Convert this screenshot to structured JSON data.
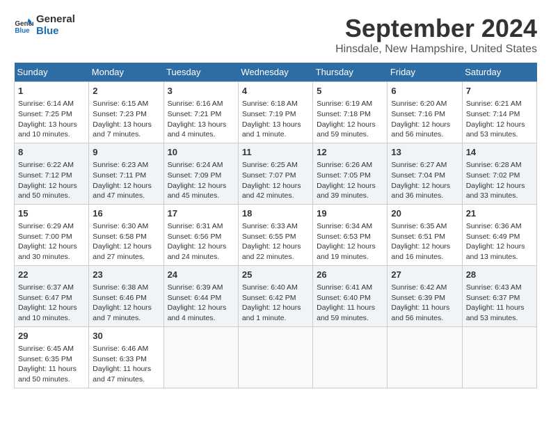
{
  "logo": {
    "text_general": "General",
    "text_blue": "Blue"
  },
  "title": {
    "month_year": "September 2024",
    "location": "Hinsdale, New Hampshire, United States"
  },
  "headers": [
    "Sunday",
    "Monday",
    "Tuesday",
    "Wednesday",
    "Thursday",
    "Friday",
    "Saturday"
  ],
  "weeks": [
    [
      {
        "day": 1,
        "sunrise": "6:14 AM",
        "sunset": "7:25 PM",
        "daylight": "13 hours and 10 minutes."
      },
      {
        "day": 2,
        "sunrise": "6:15 AM",
        "sunset": "7:23 PM",
        "daylight": "13 hours and 7 minutes."
      },
      {
        "day": 3,
        "sunrise": "6:16 AM",
        "sunset": "7:21 PM",
        "daylight": "13 hours and 4 minutes."
      },
      {
        "day": 4,
        "sunrise": "6:18 AM",
        "sunset": "7:19 PM",
        "daylight": "13 hours and 1 minute."
      },
      {
        "day": 5,
        "sunrise": "6:19 AM",
        "sunset": "7:18 PM",
        "daylight": "12 hours and 59 minutes."
      },
      {
        "day": 6,
        "sunrise": "6:20 AM",
        "sunset": "7:16 PM",
        "daylight": "12 hours and 56 minutes."
      },
      {
        "day": 7,
        "sunrise": "6:21 AM",
        "sunset": "7:14 PM",
        "daylight": "12 hours and 53 minutes."
      }
    ],
    [
      {
        "day": 8,
        "sunrise": "6:22 AM",
        "sunset": "7:12 PM",
        "daylight": "12 hours and 50 minutes."
      },
      {
        "day": 9,
        "sunrise": "6:23 AM",
        "sunset": "7:11 PM",
        "daylight": "12 hours and 47 minutes."
      },
      {
        "day": 10,
        "sunrise": "6:24 AM",
        "sunset": "7:09 PM",
        "daylight": "12 hours and 45 minutes."
      },
      {
        "day": 11,
        "sunrise": "6:25 AM",
        "sunset": "7:07 PM",
        "daylight": "12 hours and 42 minutes."
      },
      {
        "day": 12,
        "sunrise": "6:26 AM",
        "sunset": "7:05 PM",
        "daylight": "12 hours and 39 minutes."
      },
      {
        "day": 13,
        "sunrise": "6:27 AM",
        "sunset": "7:04 PM",
        "daylight": "12 hours and 36 minutes."
      },
      {
        "day": 14,
        "sunrise": "6:28 AM",
        "sunset": "7:02 PM",
        "daylight": "12 hours and 33 minutes."
      }
    ],
    [
      {
        "day": 15,
        "sunrise": "6:29 AM",
        "sunset": "7:00 PM",
        "daylight": "12 hours and 30 minutes."
      },
      {
        "day": 16,
        "sunrise": "6:30 AM",
        "sunset": "6:58 PM",
        "daylight": "12 hours and 27 minutes."
      },
      {
        "day": 17,
        "sunrise": "6:31 AM",
        "sunset": "6:56 PM",
        "daylight": "12 hours and 24 minutes."
      },
      {
        "day": 18,
        "sunrise": "6:33 AM",
        "sunset": "6:55 PM",
        "daylight": "12 hours and 22 minutes."
      },
      {
        "day": 19,
        "sunrise": "6:34 AM",
        "sunset": "6:53 PM",
        "daylight": "12 hours and 19 minutes."
      },
      {
        "day": 20,
        "sunrise": "6:35 AM",
        "sunset": "6:51 PM",
        "daylight": "12 hours and 16 minutes."
      },
      {
        "day": 21,
        "sunrise": "6:36 AM",
        "sunset": "6:49 PM",
        "daylight": "12 hours and 13 minutes."
      }
    ],
    [
      {
        "day": 22,
        "sunrise": "6:37 AM",
        "sunset": "6:47 PM",
        "daylight": "12 hours and 10 minutes."
      },
      {
        "day": 23,
        "sunrise": "6:38 AM",
        "sunset": "6:46 PM",
        "daylight": "12 hours and 7 minutes."
      },
      {
        "day": 24,
        "sunrise": "6:39 AM",
        "sunset": "6:44 PM",
        "daylight": "12 hours and 4 minutes."
      },
      {
        "day": 25,
        "sunrise": "6:40 AM",
        "sunset": "6:42 PM",
        "daylight": "12 hours and 1 minute."
      },
      {
        "day": 26,
        "sunrise": "6:41 AM",
        "sunset": "6:40 PM",
        "daylight": "11 hours and 59 minutes."
      },
      {
        "day": 27,
        "sunrise": "6:42 AM",
        "sunset": "6:39 PM",
        "daylight": "11 hours and 56 minutes."
      },
      {
        "day": 28,
        "sunrise": "6:43 AM",
        "sunset": "6:37 PM",
        "daylight": "11 hours and 53 minutes."
      }
    ],
    [
      {
        "day": 29,
        "sunrise": "6:45 AM",
        "sunset": "6:35 PM",
        "daylight": "11 hours and 50 minutes."
      },
      {
        "day": 30,
        "sunrise": "6:46 AM",
        "sunset": "6:33 PM",
        "daylight": "11 hours and 47 minutes."
      },
      null,
      null,
      null,
      null,
      null
    ]
  ],
  "labels": {
    "sunrise": "Sunrise: ",
    "sunset": "Sunset: ",
    "daylight": "Daylight: "
  }
}
